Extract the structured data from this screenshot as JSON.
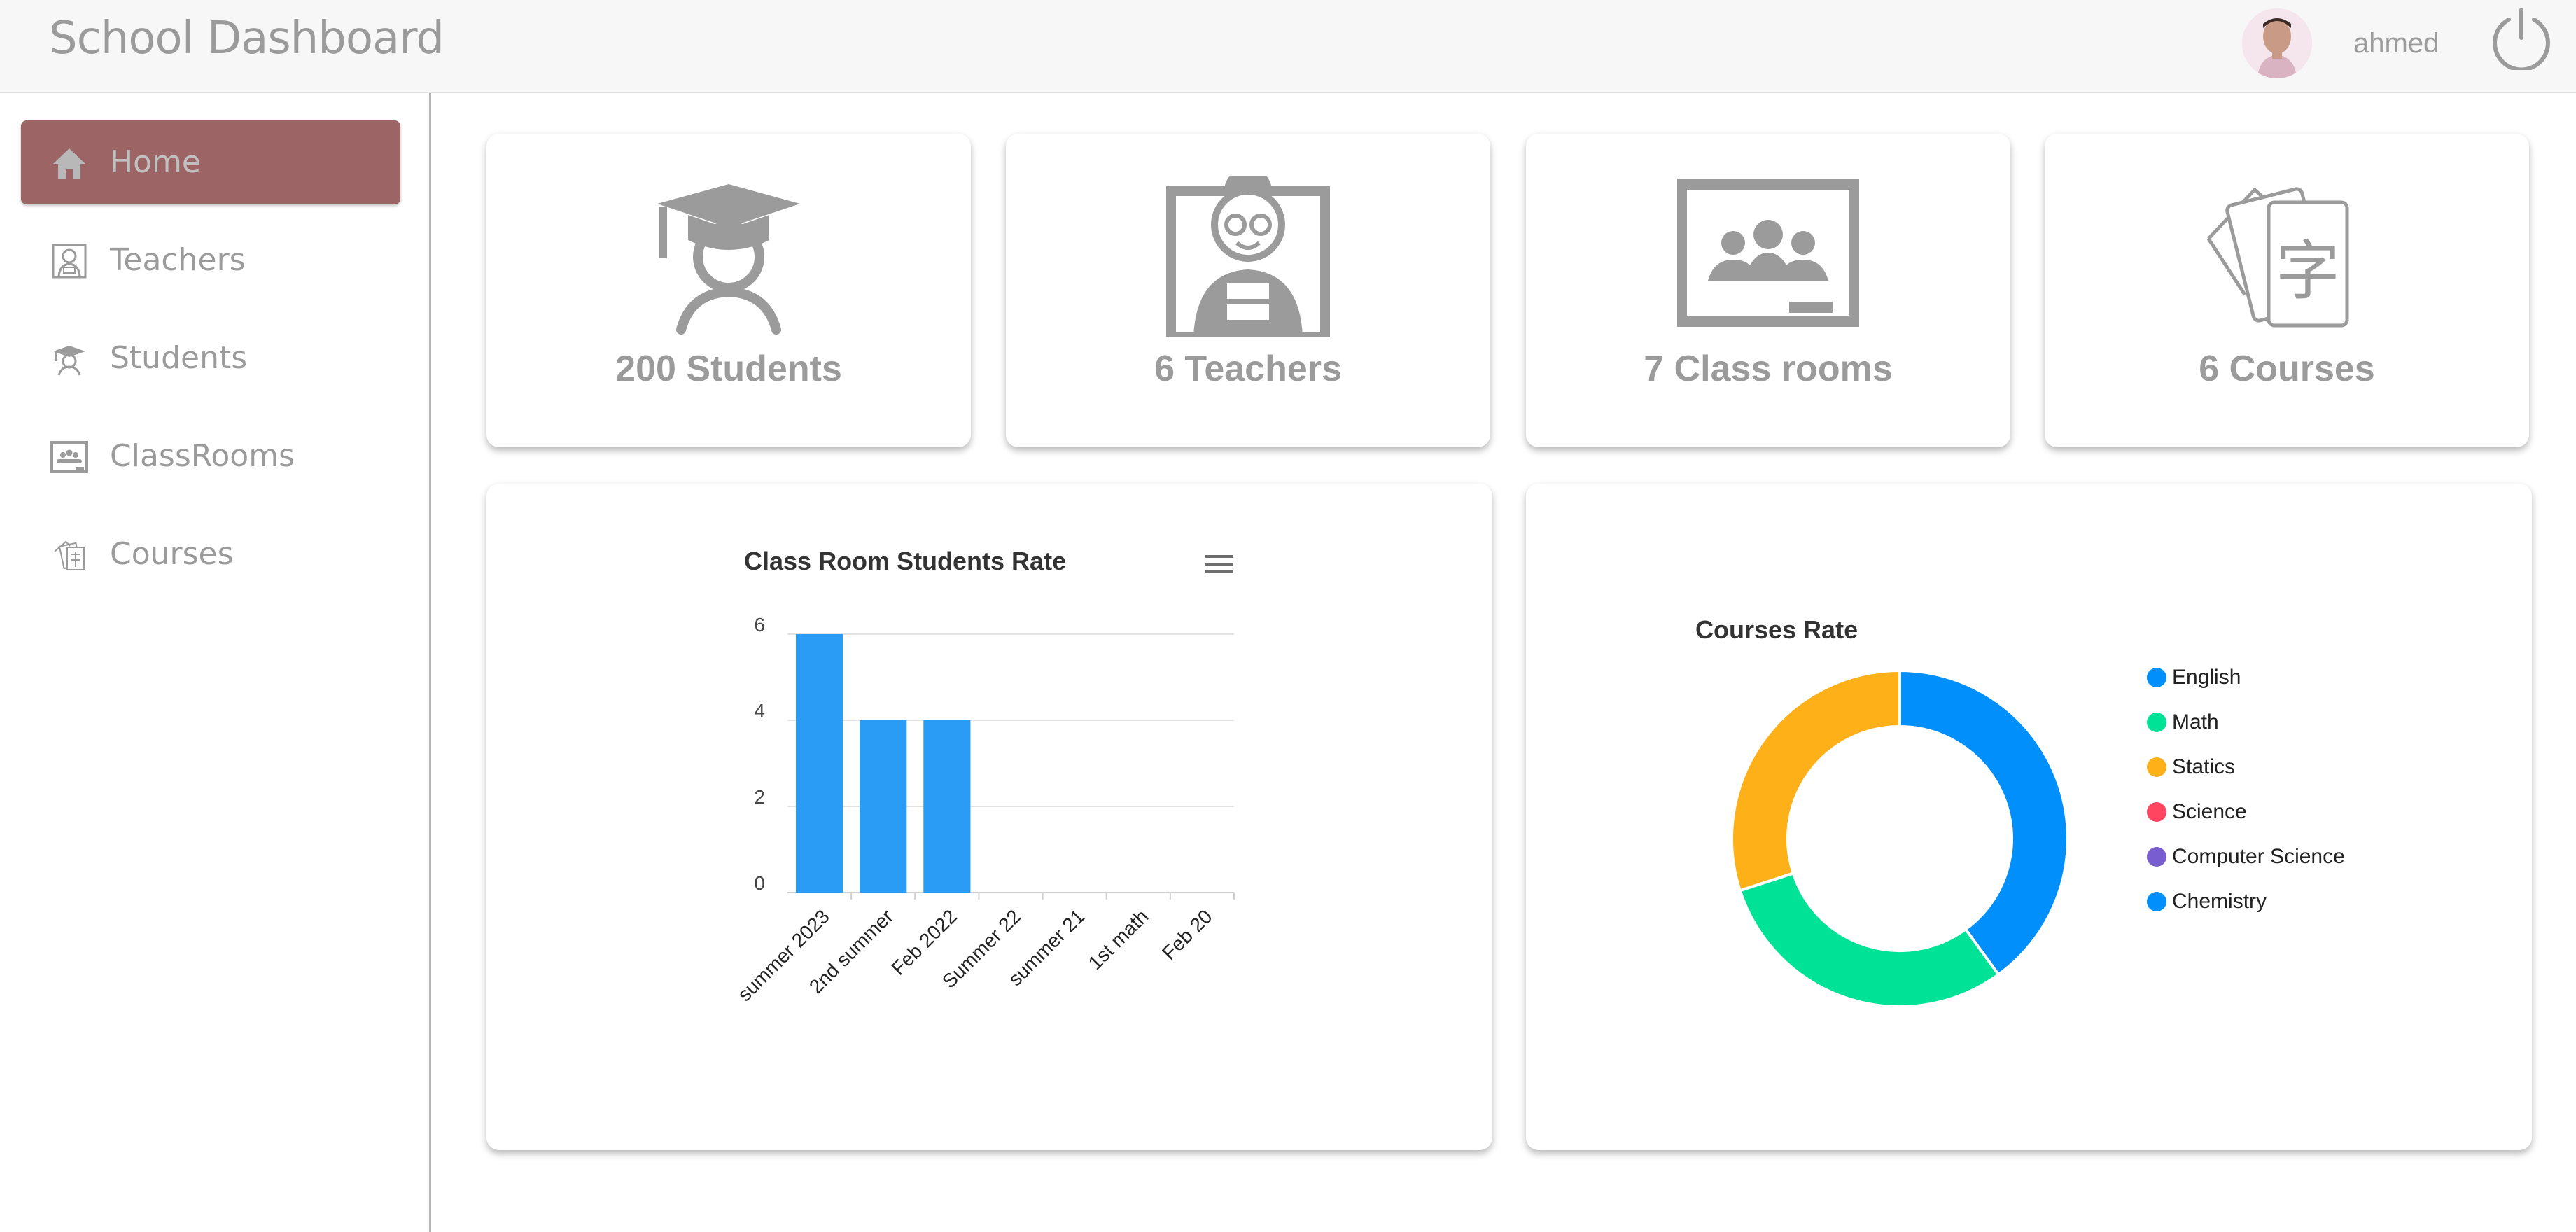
{
  "header": {
    "title": "School Dashboard",
    "username": "ahmed"
  },
  "sidebar": {
    "items": [
      {
        "label": "Home",
        "icon": "home-icon"
      },
      {
        "label": "Teachers",
        "icon": "teacher-icon"
      },
      {
        "label": "Students",
        "icon": "student-icon"
      },
      {
        "label": "ClassRooms",
        "icon": "classroom-icon"
      },
      {
        "label": "Courses",
        "icon": "courses-icon"
      }
    ],
    "active_index": 0,
    "active_color": "#9c6464"
  },
  "stats": [
    {
      "label": "200 Students",
      "icon": "graduation-cap-icon"
    },
    {
      "label": "6 Teachers",
      "icon": "teacher-icon"
    },
    {
      "label": "7 Class rooms",
      "icon": "classroom-icon"
    },
    {
      "label": "6 Courses",
      "icon": "flashcards-icon"
    }
  ],
  "chart_data": [
    {
      "type": "bar",
      "title": "Class Room Students Rate",
      "categories": [
        "summer 2023",
        "2nd summer",
        "Feb 2022",
        "Summer 22",
        "summer 21",
        "1st math",
        "Feb 20"
      ],
      "values": [
        6,
        4,
        4,
        0,
        0,
        0,
        0
      ],
      "ylim": [
        0,
        6
      ],
      "yticks": [
        "0",
        "2",
        "4",
        "6"
      ],
      "grid": true,
      "color": "#2b9cf5"
    },
    {
      "type": "pie",
      "title": "Courses Rate",
      "labels": [
        "English",
        "Math",
        "Statics",
        "Science",
        "Computer Science",
        "Chemistry"
      ],
      "values": [
        40,
        30,
        30,
        0,
        0,
        0
      ],
      "colors": [
        "#008ffb",
        "#00e396",
        "#feb019",
        "#ff4560",
        "#775dd0",
        "#008ffb"
      ],
      "legend": "right"
    }
  ]
}
